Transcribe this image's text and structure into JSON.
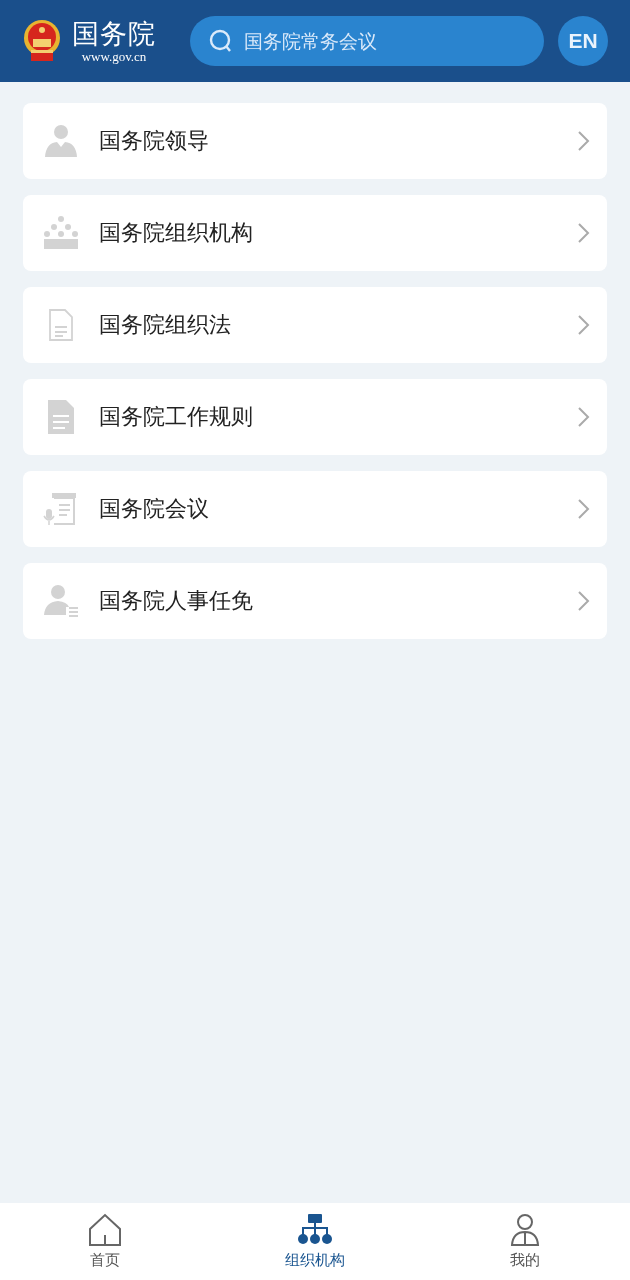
{
  "header": {
    "title": "国务院",
    "subtitle": "www.gov.cn",
    "search": {
      "placeholder": "国务院常务会议"
    },
    "language_button": "EN"
  },
  "items": [
    {
      "kind": "leader",
      "label": "国务院领导"
    },
    {
      "kind": "organization",
      "label": "国务院组织机构"
    },
    {
      "kind": "document",
      "label": "国务院组织法"
    },
    {
      "kind": "document-filled",
      "label": "国务院工作规则"
    },
    {
      "kind": "meeting",
      "label": "国务院会议"
    },
    {
      "kind": "personnel",
      "label": "国务院人事任免"
    }
  ],
  "tabs": [
    {
      "kind": "home",
      "label": "首页",
      "selected": false
    },
    {
      "kind": "organization",
      "label": "组织机构",
      "selected": true
    },
    {
      "kind": "profile",
      "label": "我的",
      "selected": false
    }
  ]
}
